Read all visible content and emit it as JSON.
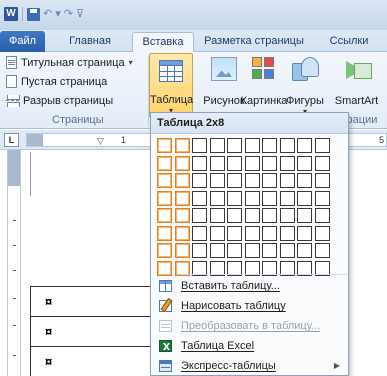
{
  "quick_access": {
    "app_icon_letter": "W",
    "icons": [
      "word-icon",
      "save-icon",
      "undo-icon",
      "redo-icon",
      "customize-icon"
    ]
  },
  "tabs": {
    "file": "Файл",
    "home": "Главная",
    "insert": "Вставка",
    "layout": "Разметка страницы",
    "links": "Ссылки"
  },
  "ribbon": {
    "pages": {
      "cover_page": "Титульная страница",
      "blank_page": "Пустая страница",
      "page_break": "Разрыв страницы",
      "group_label": "Страницы"
    },
    "table_button": "Таблица",
    "picture_button": "Рисунок",
    "clipart_button": "Картинка",
    "shapes_button": "Фигуры",
    "smartart_button": "SmartArt",
    "illustrations_label_partial": "страции"
  },
  "ruler": {
    "corner": "L",
    "numbers": [
      "1",
      "5"
    ]
  },
  "document": {
    "cell_marker": "¤",
    "rows": 3
  },
  "table_menu": {
    "header": "Таблица 2x8",
    "grid": {
      "columns": 10,
      "rows": 8,
      "selected_columns": 2,
      "selected_rows": 8
    },
    "items": [
      {
        "label": "Вставить таблицу...",
        "enabled": true,
        "icon": "insert-table-icon"
      },
      {
        "label": "Нарисовать таблицу",
        "enabled": true,
        "icon": "draw-table-icon"
      },
      {
        "label": "Преобразовать в таблицу...",
        "enabled": false,
        "icon": "convert-to-table-icon"
      },
      {
        "label": "Таблица Excel",
        "enabled": true,
        "icon": "excel-table-icon"
      },
      {
        "label": "Экспресс-таблицы",
        "enabled": true,
        "icon": "quick-tables-icon",
        "has_submenu": true
      }
    ]
  },
  "colors": {
    "file_tab": "#2b5ea8",
    "selected_button": "#ffd36b",
    "grid_highlight": "#e07f28"
  }
}
